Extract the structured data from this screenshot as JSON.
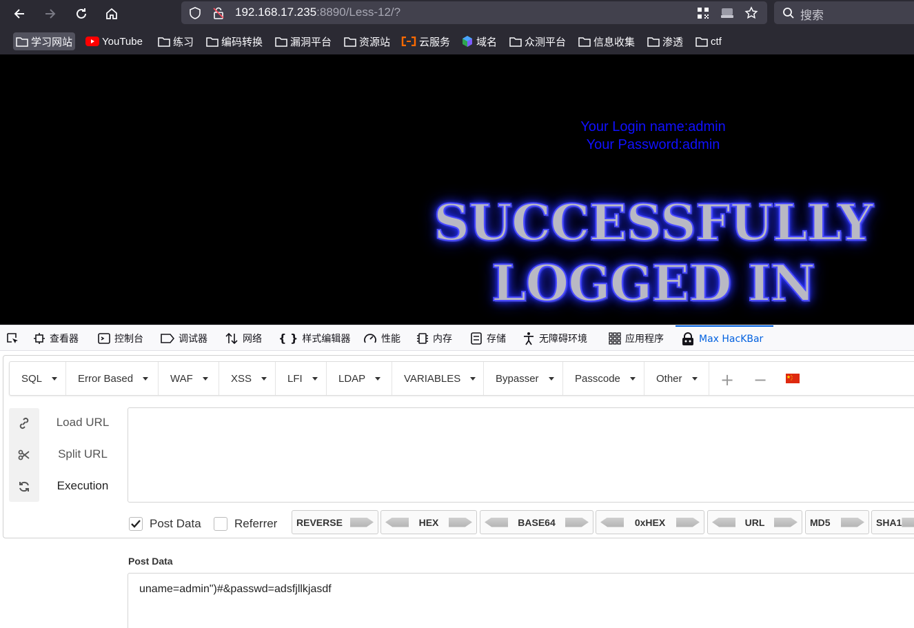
{
  "browser": {
    "url_host": "192.168.17.235",
    "url_rest": ":8890/Less-12/?",
    "search_placeholder": "搜索"
  },
  "bookmarks": [
    {
      "label": "学习网站",
      "icon": "folder-icon"
    },
    {
      "label": "YouTube",
      "icon": "youtube-icon"
    },
    {
      "label": "练习",
      "icon": "folder-icon"
    },
    {
      "label": "编码转换",
      "icon": "folder-icon"
    },
    {
      "label": "漏洞平台",
      "icon": "folder-icon"
    },
    {
      "label": "资源站",
      "icon": "folder-icon"
    },
    {
      "label": "云服务",
      "icon": "aliyun-icon"
    },
    {
      "label": "域名",
      "icon": "domain-icon"
    },
    {
      "label": "众测平台",
      "icon": "folder-icon"
    },
    {
      "label": "信息收集",
      "icon": "folder-icon"
    },
    {
      "label": "渗透",
      "icon": "folder-icon"
    },
    {
      "label": "ctf",
      "icon": "folder-icon"
    }
  ],
  "page": {
    "login_name": "Your Login name:admin",
    "password": "Your Password:admin",
    "banner_line1": "SUCCESSFULLY",
    "banner_line2": "LOGGED IN"
  },
  "devtools": {
    "tabs": [
      "查看器",
      "控制台",
      "调试器",
      "网络",
      "样式编辑器",
      "性能",
      "内存",
      "存储",
      "无障碍环境",
      "应用程序",
      "Max HacKBar"
    ],
    "active_tab": "Max HacKBar"
  },
  "hackbar": {
    "menu": [
      "SQL",
      "Error Based",
      "WAF",
      "XSS",
      "LFI",
      "LDAP",
      "VARIABLES",
      "Bypasser",
      "Passcode",
      "Other"
    ],
    "actions": {
      "load": "Load URL",
      "split": "Split URL",
      "execute": "Execution"
    },
    "url_value": "",
    "options": {
      "post_data": "Post Data",
      "post_data_checked": true,
      "referrer": "Referrer",
      "referrer_checked": false
    },
    "encoders": [
      "REVERSE",
      "HEX",
      "BASE64",
      "0xHEX",
      "URL",
      "MD5",
      "SHA1"
    ],
    "post_label": "Post Data",
    "post_value": "uname=admin\")#&passwd=adsfjllkjasdf"
  },
  "colors": {
    "accent": "#0060df",
    "login_text": "#1010ff",
    "chrome": "#2b2a33"
  }
}
